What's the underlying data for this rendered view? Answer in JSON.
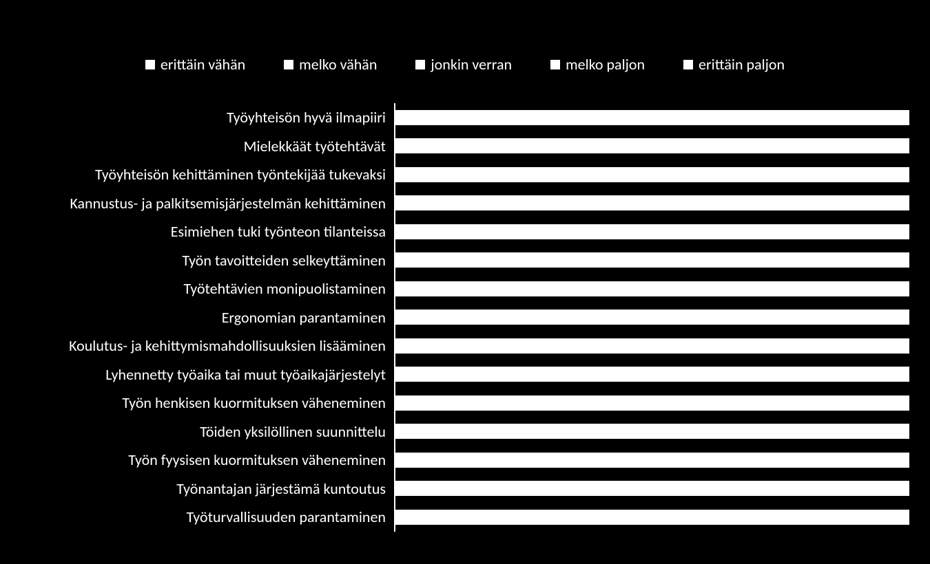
{
  "chart_data": {
    "type": "bar",
    "orientation": "horizontal",
    "stacked": true,
    "title": "",
    "xlabel": "",
    "ylabel": "",
    "xlim": [
      0,
      100
    ],
    "legend_position": "top",
    "legend": [
      "erittäin vähän",
      "melko vähän",
      "jonkin verran",
      "melko paljon",
      "erittäin paljon"
    ],
    "bar_fill_percent": 100,
    "note": "Values per segment are not readable from the image; only total bar extents (~100%) are visible as solid white bars.",
    "categories": [
      "Työyhteisön hyvä ilmapiiri",
      "Mielekkäät työtehtävät",
      "Työyhteisön kehittäminen työntekijää tukevaksi",
      "Kannustus- ja palkitsemisjärjestelmän kehittäminen",
      "Esimiehen tuki työnteon tilanteissa",
      "Työn tavoitteiden selkeyttäminen",
      "Työtehtävien monipuolistaminen",
      "Ergonomian parantaminen",
      "Koulutus- ja kehittymismahdollisuuksien lisääminen",
      "Lyhennetty työaika tai muut työaikajärjestelyt",
      "Työn henkisen kuormituksen väheneminen",
      "Töiden yksilöllinen suunnittelu",
      "Työn fyysisen kuormituksen väheneminen",
      "Työnantajan järjestämä kuntoutus",
      "Työturvallisuuden parantaminen"
    ]
  }
}
